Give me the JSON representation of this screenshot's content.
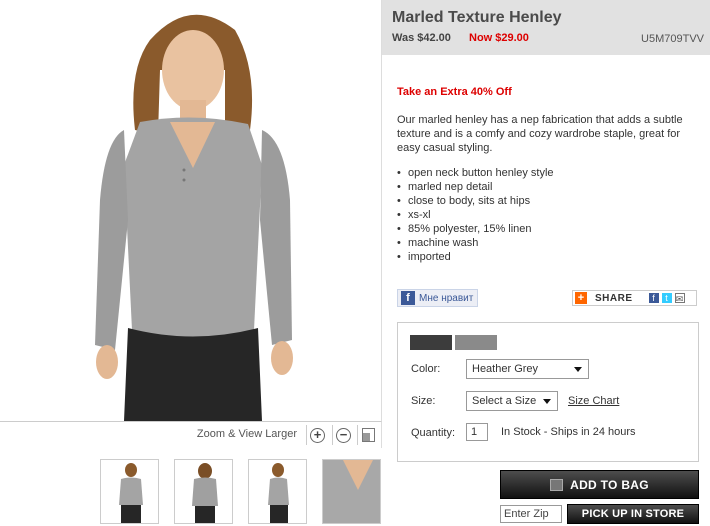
{
  "product": {
    "title": "Marled Texture Henley",
    "was_price": "Was $42.00",
    "now_price": "Now $29.00",
    "sku": "U5M709TVV",
    "promo": "Take an Extra 40% Off",
    "description": "Our marled henley has a nep fabrication that adds a subtle texture and is a comfy and cozy wardrobe staple, great for easy casual styling.",
    "features": [
      "open neck button henley style",
      "marled nep detail",
      "close to body, sits at hips",
      "xs-xl",
      "85% polyester, 15% linen",
      "machine wash",
      "imported"
    ]
  },
  "image_viewer": {
    "zoom_label": "Zoom & View Larger",
    "zoom_in_icon": "plus-circle-icon",
    "zoom_out_icon": "minus-circle-icon",
    "fullscreen_icon": "enlarge-icon"
  },
  "social": {
    "like_label": "Мне нравит",
    "share_label": "SHARE"
  },
  "options": {
    "swatches": [
      {
        "name": "charcoal",
        "color": "#3c3c3c"
      },
      {
        "name": "heather-grey",
        "color": "#8a8a8a"
      }
    ],
    "color_label": "Color:",
    "color_value": "Heather Grey",
    "size_label": "Size:",
    "size_value": "Select a Size",
    "size_chart_label": "Size Chart",
    "quantity_label": "Quantity:",
    "quantity_value": "1",
    "stock_text": "In Stock - Ships in 24 hours"
  },
  "actions": {
    "add_to_bag": "ADD TO BAG",
    "zip_placeholder": "Enter Zip",
    "pickup": "PICK UP IN STORE"
  },
  "colors": {
    "sale_red": "#dd0000",
    "header_grey": "#e1e1e1",
    "button_black": "#111111"
  }
}
